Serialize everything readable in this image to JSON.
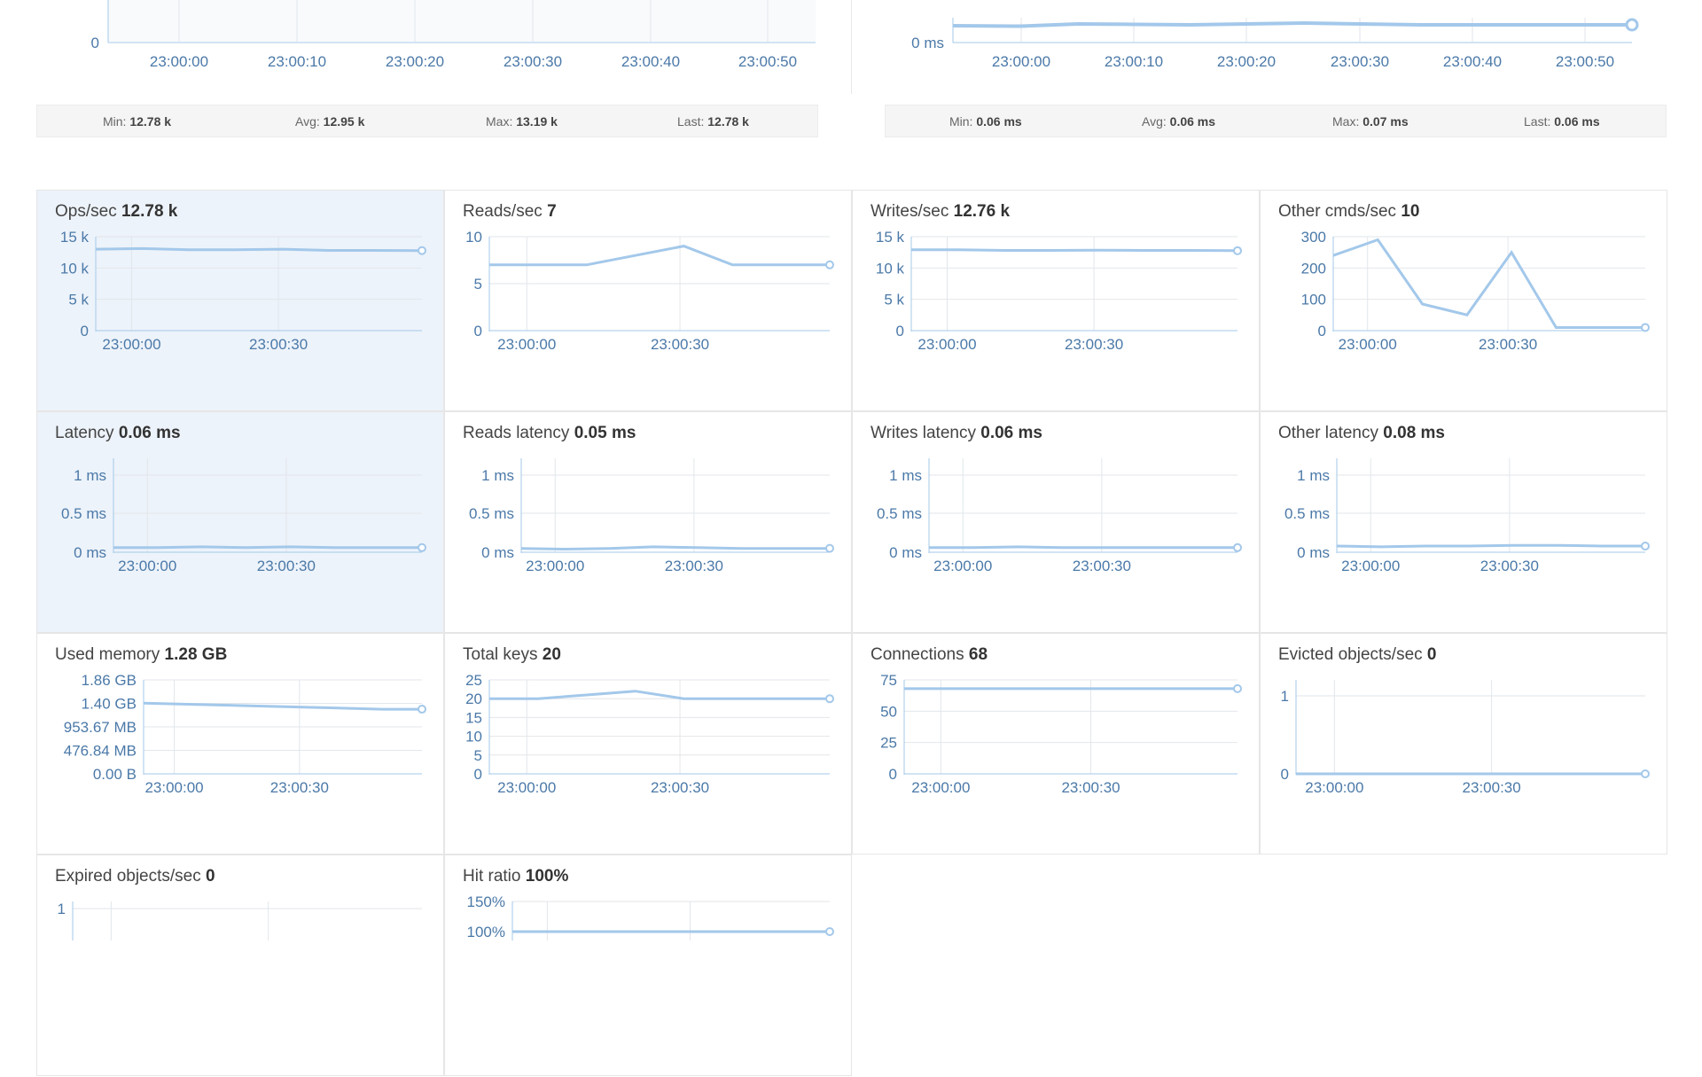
{
  "top_charts": [
    {
      "name": "ops-overview",
      "y_ticks": [
        "0"
      ],
      "x_ticks": [
        "23:00:00",
        "23:00:10",
        "23:00:20",
        "23:00:30",
        "23:00:40",
        "23:00:50"
      ],
      "stats": {
        "min_label": "Min:",
        "min": "12.78 k",
        "avg_label": "Avg:",
        "avg": "12.95 k",
        "max_label": "Max:",
        "max": "13.19 k",
        "last_label": "Last:",
        "last": "12.78 k"
      }
    },
    {
      "name": "latency-overview",
      "y_ticks": [
        "0 ms"
      ],
      "x_ticks": [
        "23:00:00",
        "23:00:10",
        "23:00:20",
        "23:00:30",
        "23:00:40",
        "23:00:50"
      ],
      "stats": {
        "min_label": "Min:",
        "min": "0.06 ms",
        "avg_label": "Avg:",
        "avg": "0.06 ms",
        "max_label": "Max:",
        "max": "0.07 ms",
        "last_label": "Last:",
        "last": "0.06 ms"
      }
    }
  ],
  "panels": [
    {
      "label": "Ops/sec",
      "value": "12.78 k",
      "y_ticks": [
        "15 k",
        "10 k",
        "5 k",
        "0"
      ],
      "x_ticks": [
        "23:00:00",
        "23:00:30"
      ],
      "series": [
        13000,
        13100,
        12900,
        12900,
        13000,
        12800,
        12800,
        12780
      ],
      "ymax": 15000
    },
    {
      "label": "Reads/sec",
      "value": "7",
      "y_ticks": [
        "10",
        "5",
        "0"
      ],
      "x_ticks": [
        "23:00:00",
        "23:00:30"
      ],
      "series": [
        7,
        7,
        7,
        8,
        9,
        7,
        7,
        7
      ],
      "ymax": 10
    },
    {
      "label": "Writes/sec",
      "value": "12.76 k",
      "y_ticks": [
        "15 k",
        "10 k",
        "5 k",
        "0"
      ],
      "x_ticks": [
        "23:00:00",
        "23:00:30"
      ],
      "series": [
        12900,
        12900,
        12800,
        12800,
        12850,
        12800,
        12800,
        12760
      ],
      "ymax": 15000
    },
    {
      "label": "Other cmds/sec",
      "value": "10",
      "y_ticks": [
        "300",
        "200",
        "100",
        "0"
      ],
      "x_ticks": [
        "23:00:00",
        "23:00:30"
      ],
      "series": [
        240,
        290,
        85,
        50,
        250,
        10,
        10,
        10
      ],
      "ymax": 300
    },
    {
      "label": "Latency",
      "value": "0.06 ms",
      "y_ticks": [
        "1 ms",
        "0.5 ms",
        "0 ms"
      ],
      "x_ticks": [
        "23:00:00",
        "23:00:30"
      ],
      "series": [
        0.06,
        0.06,
        0.07,
        0.06,
        0.07,
        0.06,
        0.06,
        0.06
      ],
      "ymax": 1.2
    },
    {
      "label": "Reads latency",
      "value": "0.05 ms",
      "y_ticks": [
        "1 ms",
        "0.5 ms",
        "0 ms"
      ],
      "x_ticks": [
        "23:00:00",
        "23:00:30"
      ],
      "series": [
        0.05,
        0.04,
        0.05,
        0.07,
        0.06,
        0.05,
        0.05,
        0.05
      ],
      "ymax": 1.2
    },
    {
      "label": "Writes latency",
      "value": "0.06 ms",
      "y_ticks": [
        "1 ms",
        "0.5 ms",
        "0 ms"
      ],
      "x_ticks": [
        "23:00:00",
        "23:00:30"
      ],
      "series": [
        0.06,
        0.06,
        0.07,
        0.06,
        0.06,
        0.06,
        0.06,
        0.06
      ],
      "ymax": 1.2
    },
    {
      "label": "Other latency",
      "value": "0.08 ms",
      "y_ticks": [
        "1 ms",
        "0.5 ms",
        "0 ms"
      ],
      "x_ticks": [
        "23:00:00",
        "23:00:30"
      ],
      "series": [
        0.08,
        0.07,
        0.08,
        0.08,
        0.09,
        0.09,
        0.08,
        0.08
      ],
      "ymax": 1.2
    },
    {
      "label": "Used memory",
      "value": "1.28 GB",
      "y_ticks": [
        "1.86 GB",
        "1.40 GB",
        "953.67 MB",
        "476.84 MB",
        "0.00 B"
      ],
      "x_ticks": [
        "23:00:00",
        "23:00:30"
      ],
      "series": [
        1.4,
        1.38,
        1.36,
        1.34,
        1.32,
        1.3,
        1.28,
        1.28
      ],
      "ymax": 1.86
    },
    {
      "label": "Total keys",
      "value": "20",
      "y_ticks": [
        "25",
        "20",
        "15",
        "10",
        "5",
        "0"
      ],
      "x_ticks": [
        "23:00:00",
        "23:00:30"
      ],
      "series": [
        20,
        20,
        21,
        22,
        20,
        20,
        20,
        20
      ],
      "ymax": 25
    },
    {
      "label": "Connections",
      "value": "68",
      "y_ticks": [
        "75",
        "50",
        "25",
        "0"
      ],
      "x_ticks": [
        "23:00:00",
        "23:00:30"
      ],
      "series": [
        68,
        68,
        68,
        68,
        68,
        68,
        68,
        68
      ],
      "ymax": 75
    },
    {
      "label": "Evicted objects/sec",
      "value": "0",
      "y_ticks": [
        "1",
        "0"
      ],
      "x_ticks": [
        "23:00:00",
        "23:00:30"
      ],
      "series": [
        0,
        0,
        0,
        0,
        0,
        0,
        0,
        0
      ],
      "ymax": 1.2
    },
    {
      "label": "Expired objects/sec",
      "value": "0",
      "y_ticks": [
        "1"
      ],
      "x_ticks": [],
      "series": [],
      "ymax": 1.2
    },
    {
      "label": "Hit ratio",
      "value": "100%",
      "y_ticks": [
        "150%",
        "100%"
      ],
      "x_ticks": [],
      "series": [
        100,
        100,
        100,
        100,
        100,
        100,
        100,
        100
      ],
      "ymax": 150
    }
  ],
  "colors": {
    "line": "#a3c8ea",
    "grid": "#e2e6eb",
    "axis": "#a3c8ea",
    "tick_text": "#4b79a8",
    "active_panel": "#edf3fa"
  }
}
